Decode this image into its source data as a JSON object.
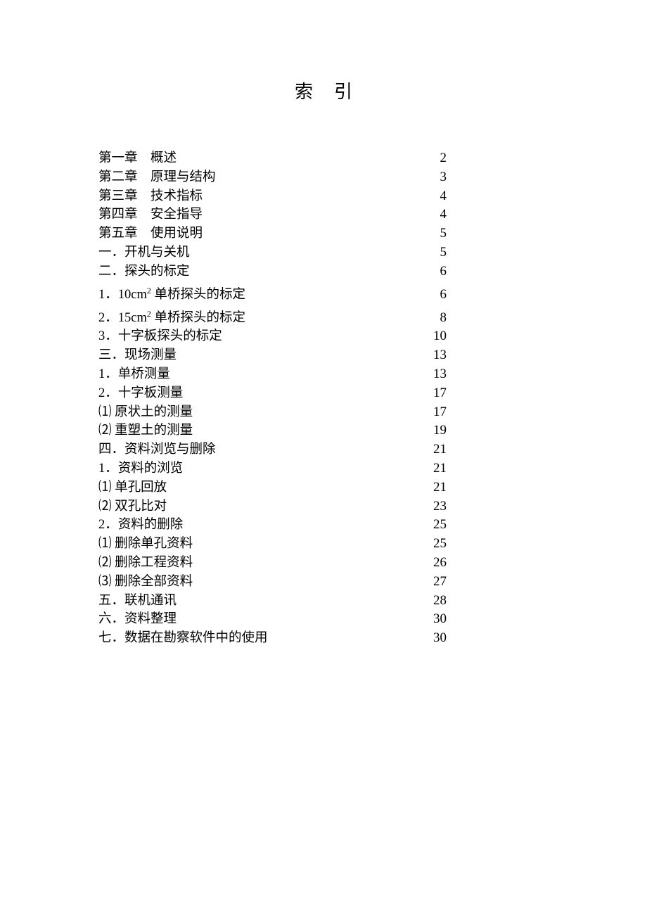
{
  "title": "索引",
  "entries": [
    {
      "label": "第一章　概述",
      "page": "2"
    },
    {
      "label": "第二章　原理与结构",
      "page": "3"
    },
    {
      "label": "第三章　技术指标",
      "page": "4"
    },
    {
      "label": "第四章　安全指导",
      "page": "4"
    },
    {
      "label": "第五章　使用说明",
      "page": "5"
    },
    {
      "label": "一．开机与关机",
      "page": "5"
    },
    {
      "label": "二．探头的标定",
      "page": "6"
    },
    {
      "label": "1．10cm²单桥探头的标定",
      "page": "6",
      "sup": true
    },
    {
      "label": "2．15cm²单桥探头的标定",
      "page": "8",
      "sup": true
    },
    {
      "label": "3．十字板探头的标定",
      "page": "10"
    },
    {
      "label": "三．现场测量",
      "page": "13"
    },
    {
      "label": "1．单桥测量",
      "page": "13"
    },
    {
      "label": "2．十字板测量",
      "page": "17"
    },
    {
      "label": "⑴ 原状土的测量",
      "page": "17"
    },
    {
      "label": "⑵ 重塑土的测量",
      "page": "19"
    },
    {
      "label": "四．资料浏览与删除",
      "page": "21"
    },
    {
      "label": "1．资料的浏览",
      "page": "21"
    },
    {
      "label": "⑴ 单孔回放",
      "page": "21"
    },
    {
      "label": "⑵ 双孔比对",
      "page": "23"
    },
    {
      "label": "2．资料的删除",
      "page": "25"
    },
    {
      "label": "⑴ 删除单孔资料",
      "page": "25"
    },
    {
      "label": "⑵ 删除工程资料",
      "page": "26"
    },
    {
      "label": "⑶ 删除全部资料",
      "page": "27"
    },
    {
      "label": "五．联机通讯",
      "page": "28"
    },
    {
      "label": "六．资料整理",
      "page": "30"
    },
    {
      "label": "七．数据在勘察软件中的使用",
      "page": "30"
    }
  ]
}
